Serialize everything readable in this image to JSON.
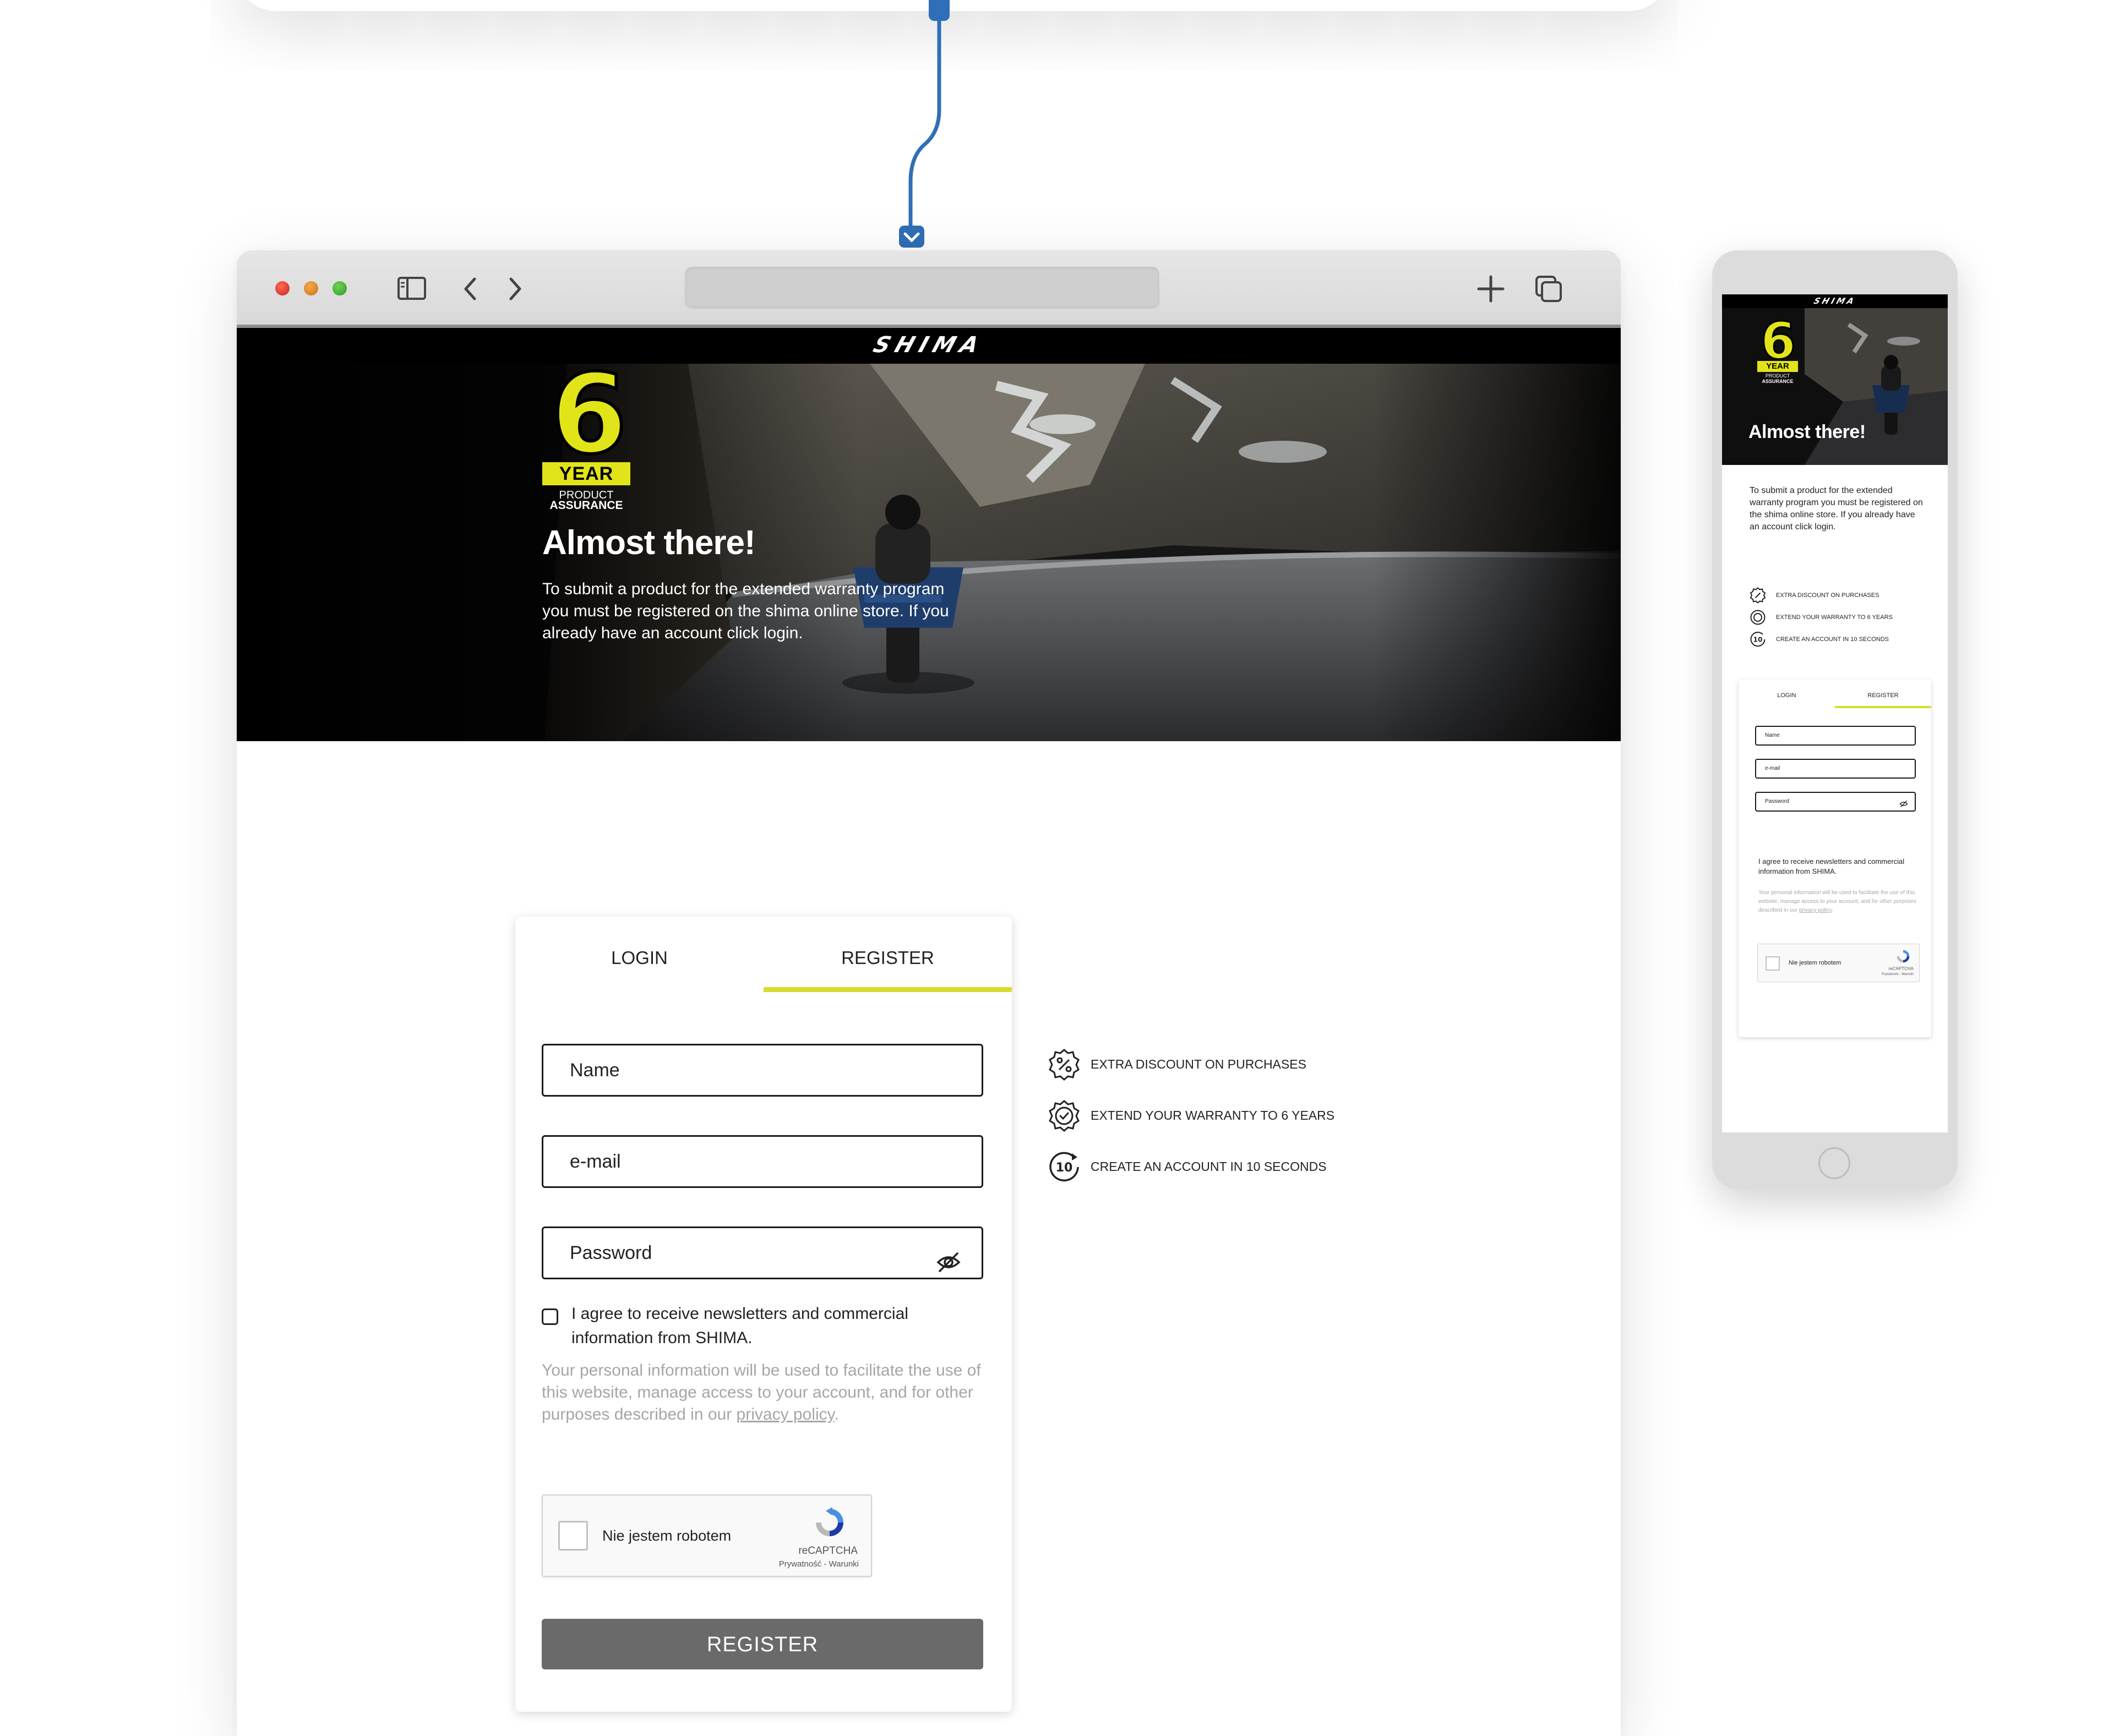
{
  "brand": {
    "logo_text": "SHIMA"
  },
  "colors": {
    "accent": "#d7dd2a",
    "badge_yellow": "#e2e41a",
    "button_bg": "#6a6a6a",
    "connector_blue": "#2f6fb7"
  },
  "browser": {
    "icons": [
      "sidebar-icon",
      "back-arrow-icon",
      "forward-arrow-icon",
      "plus-icon",
      "tabs-overview-icon"
    ]
  },
  "badge": {
    "number": "6",
    "year": "YEAR",
    "product": "PRODUCT",
    "assurance": "ASSURANCE"
  },
  "hero": {
    "title": "Almost there!",
    "text": "To submit a product for the extended warranty program you must be registered on the shima online store. If you already have an account click login."
  },
  "tabs": {
    "login": "LOGIN",
    "register": "REGISTER"
  },
  "form": {
    "name_placeholder": "Name",
    "email_placeholder": "e-mail",
    "password_placeholder": "Password",
    "agree_text": "I agree to receive newsletters and commercial information from SHIMA.",
    "privacy_prefix": "Your personal information will be used to facilitate the use of this website, manage access to your account, and for other purposes described in our ",
    "privacy_link": "privacy policy",
    "privacy_suffix": ".",
    "submit_label": "REGISTER"
  },
  "captcha": {
    "label": "Nie jestem robotem",
    "brand": "reCAPTCHA",
    "terms": "Prywatność - Warunki"
  },
  "benefits": [
    {
      "icon": "discount-badge-icon",
      "label": "EXTRA DISCOUNT ON PURCHASES"
    },
    {
      "icon": "check-badge-icon",
      "label": "EXTEND YOUR WARRANTY TO 6 YEARS"
    },
    {
      "icon": "ten-seconds-icon",
      "label": "CREATE AN ACCOUNT IN 10 SECONDS"
    }
  ],
  "mobile": {
    "logo_text": "SHIMA",
    "title": "Almost there!",
    "text": "To submit a product for the extended warranty program you must be registered on the shima online store. If you already have an account click login.",
    "benefits": [
      "EXTRA DISCOUNT ON PURCHASES",
      "EXTEND YOUR WARRANTY TO 6 YEARS",
      "CREATE AN ACCOUNT IN 10 SECONDS"
    ],
    "tabs": {
      "login": "LOGIN",
      "register": "REGISTER"
    },
    "name_placeholder": "Name",
    "email_placeholder": "e-mail",
    "password_placeholder": "Password",
    "agree_text": "I agree to receive newsletters and commercial information from SHIMA.",
    "privacy_prefix": "Your personal information will be used to facilitate the use of this website, manage access to your account, and for other purposes described in our ",
    "privacy_link": "privacy policy",
    "privacy_suffix": ".",
    "captcha_label": "Nie jestem robotem",
    "captcha_brand": "reCAPTCHA",
    "captcha_terms": "Prywatność - Warunki"
  }
}
